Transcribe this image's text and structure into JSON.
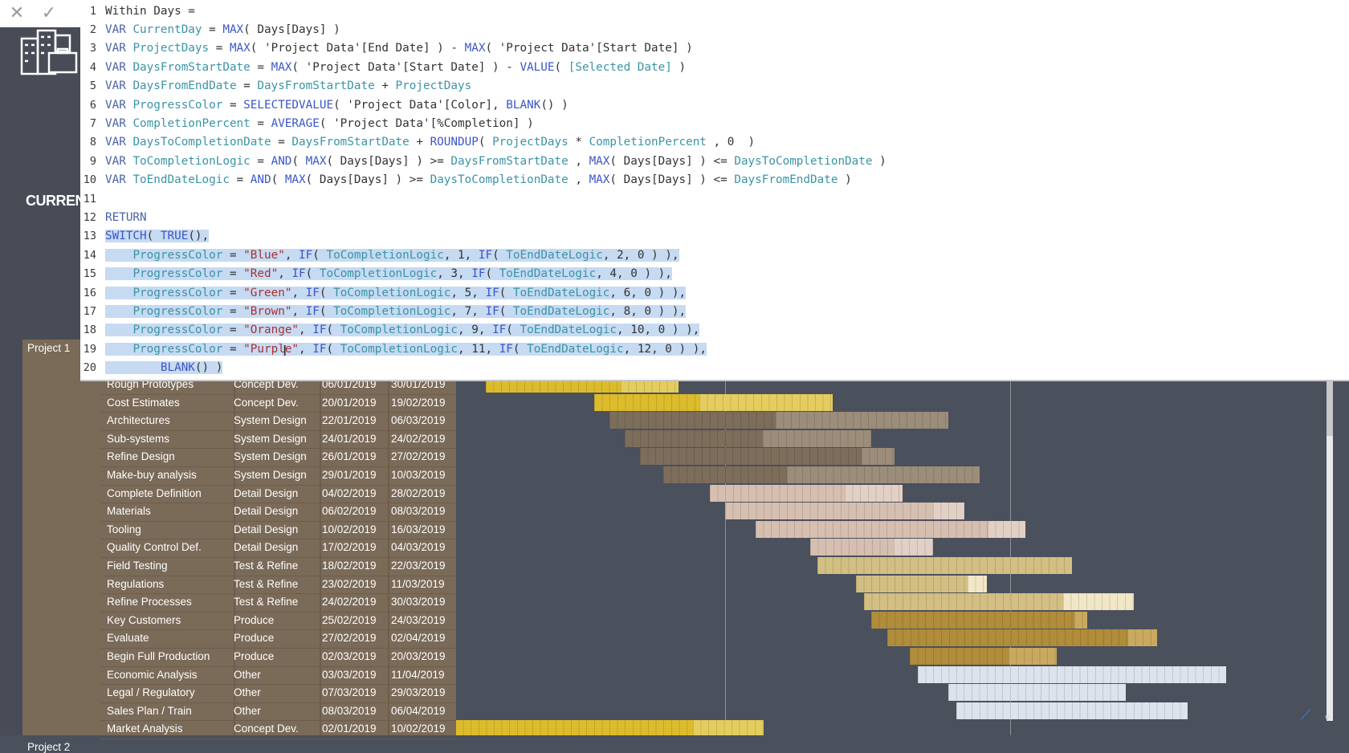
{
  "toolbar": {
    "cancel_icon": "close-icon",
    "commit_icon": "check-icon"
  },
  "left_panel": {
    "logo": "buildings-briefcase-icon",
    "label": "CURREN"
  },
  "editor": {
    "lines": [
      [
        [
          "Within Days =",
          "p"
        ]
      ],
      [
        [
          "VAR ",
          "k"
        ],
        [
          "CurrentDay",
          "v"
        ],
        [
          " = ",
          "p"
        ],
        [
          "MAX",
          "f"
        ],
        [
          "( Days[Days] )",
          "p"
        ]
      ],
      [
        [
          "VAR ",
          "k"
        ],
        [
          "ProjectDays",
          "v"
        ],
        [
          " = ",
          "p"
        ],
        [
          "MAX",
          "f"
        ],
        [
          "( 'Project Data'[End Date] ) - ",
          "p"
        ],
        [
          "MAX",
          "f"
        ],
        [
          "( 'Project Data'[Start Date] )",
          "p"
        ]
      ],
      [
        [
          "VAR ",
          "k"
        ],
        [
          "DaysFromStartDate",
          "v"
        ],
        [
          " = ",
          "p"
        ],
        [
          "MAX",
          "f"
        ],
        [
          "( 'Project Data'[Start Date] ) - ",
          "p"
        ],
        [
          "VALUE",
          "f"
        ],
        [
          "( ",
          "p"
        ],
        [
          "[Selected Date]",
          "v"
        ],
        [
          " )",
          "p"
        ]
      ],
      [
        [
          "VAR ",
          "k"
        ],
        [
          "DaysFromEndDate",
          "v"
        ],
        [
          " = ",
          "p"
        ],
        [
          "DaysFromStartDate",
          "v"
        ],
        [
          " + ",
          "p"
        ],
        [
          "ProjectDays",
          "v"
        ]
      ],
      [
        [
          "VAR ",
          "k"
        ],
        [
          "ProgressColor",
          "v"
        ],
        [
          " = ",
          "p"
        ],
        [
          "SELECTEDVALUE",
          "f"
        ],
        [
          "( 'Project Data'[Color], ",
          "p"
        ],
        [
          "BLANK",
          "f"
        ],
        [
          "() )",
          "p"
        ]
      ],
      [
        [
          "VAR ",
          "k"
        ],
        [
          "CompletionPercent",
          "v"
        ],
        [
          " = ",
          "p"
        ],
        [
          "AVERAGE",
          "f"
        ],
        [
          "( 'Project Data'[%Completion] )",
          "p"
        ]
      ],
      [
        [
          "VAR ",
          "k"
        ],
        [
          "DaysToCompletionDate",
          "v"
        ],
        [
          " = ",
          "p"
        ],
        [
          "DaysFromStartDate",
          "v"
        ],
        [
          " + ",
          "p"
        ],
        [
          "ROUNDUP",
          "f"
        ],
        [
          "( ",
          "p"
        ],
        [
          "ProjectDays",
          "v"
        ],
        [
          " * ",
          "p"
        ],
        [
          "CompletionPercent",
          "v"
        ],
        [
          " , 0  )",
          "p"
        ]
      ],
      [
        [
          "VAR ",
          "k"
        ],
        [
          "ToCompletionLogic",
          "v"
        ],
        [
          " = ",
          "p"
        ],
        [
          "AND",
          "f"
        ],
        [
          "( ",
          "p"
        ],
        [
          "MAX",
          "f"
        ],
        [
          "( Days[Days] ) >= ",
          "p"
        ],
        [
          "DaysFromStartDate",
          "v"
        ],
        [
          " , ",
          "p"
        ],
        [
          "MAX",
          "f"
        ],
        [
          "( Days[Days] ) <= ",
          "p"
        ],
        [
          "DaysToCompletionDate",
          "v"
        ],
        [
          " )",
          "p"
        ]
      ],
      [
        [
          "VAR ",
          "k"
        ],
        [
          "ToEndDateLogic",
          "v"
        ],
        [
          " = ",
          "p"
        ],
        [
          "AND",
          "f"
        ],
        [
          "( ",
          "p"
        ],
        [
          "MAX",
          "f"
        ],
        [
          "( Days[Days] ) >= ",
          "p"
        ],
        [
          "DaysToCompletionDate",
          "v"
        ],
        [
          " , ",
          "p"
        ],
        [
          "MAX",
          "f"
        ],
        [
          "( Days[Days] ) <= ",
          "p"
        ],
        [
          "DaysFromEndDate",
          "v"
        ],
        [
          " )",
          "p"
        ]
      ],
      [],
      [
        [
          "RETURN",
          "k"
        ]
      ],
      [
        [
          "SWITCH",
          "f"
        ],
        [
          "( ",
          "p"
        ],
        [
          "TRUE",
          "f"
        ],
        [
          "(),",
          "p"
        ]
      ],
      [
        [
          "    ",
          "p"
        ],
        [
          "ProgressColor",
          "v"
        ],
        [
          " = ",
          "p"
        ],
        [
          "\"Blue\"",
          "s"
        ],
        [
          ", ",
          "p"
        ],
        [
          "IF",
          "f"
        ],
        [
          "( ",
          "p"
        ],
        [
          "ToCompletionLogic",
          "v"
        ],
        [
          ", 1, ",
          "p"
        ],
        [
          "IF",
          "f"
        ],
        [
          "( ",
          "p"
        ],
        [
          "ToEndDateLogic",
          "v"
        ],
        [
          ", 2, 0 ) ),",
          "p"
        ]
      ],
      [
        [
          "    ",
          "p"
        ],
        [
          "ProgressColor",
          "v"
        ],
        [
          " = ",
          "p"
        ],
        [
          "\"Red\"",
          "s"
        ],
        [
          ", ",
          "p"
        ],
        [
          "IF",
          "f"
        ],
        [
          "( ",
          "p"
        ],
        [
          "ToCompletionLogic",
          "v"
        ],
        [
          ", 3, ",
          "p"
        ],
        [
          "IF",
          "f"
        ],
        [
          "( ",
          "p"
        ],
        [
          "ToEndDateLogic",
          "v"
        ],
        [
          ", 4, 0 ) ),",
          "p"
        ]
      ],
      [
        [
          "    ",
          "p"
        ],
        [
          "ProgressColor",
          "v"
        ],
        [
          " = ",
          "p"
        ],
        [
          "\"Green\"",
          "s"
        ],
        [
          ", ",
          "p"
        ],
        [
          "IF",
          "f"
        ],
        [
          "( ",
          "p"
        ],
        [
          "ToCompletionLogic",
          "v"
        ],
        [
          ", 5, ",
          "p"
        ],
        [
          "IF",
          "f"
        ],
        [
          "( ",
          "p"
        ],
        [
          "ToEndDateLogic",
          "v"
        ],
        [
          ", 6, 0 ) ),",
          "p"
        ]
      ],
      [
        [
          "    ",
          "p"
        ],
        [
          "ProgressColor",
          "v"
        ],
        [
          " = ",
          "p"
        ],
        [
          "\"Brown\"",
          "s"
        ],
        [
          ", ",
          "p"
        ],
        [
          "IF",
          "f"
        ],
        [
          "( ",
          "p"
        ],
        [
          "ToCompletionLogic",
          "v"
        ],
        [
          ", 7, ",
          "p"
        ],
        [
          "IF",
          "f"
        ],
        [
          "( ",
          "p"
        ],
        [
          "ToEndDateLogic",
          "v"
        ],
        [
          ", 8, 0 ) ),",
          "p"
        ]
      ],
      [
        [
          "    ",
          "p"
        ],
        [
          "ProgressColor",
          "v"
        ],
        [
          " = ",
          "p"
        ],
        [
          "\"Orange\"",
          "s"
        ],
        [
          ", ",
          "p"
        ],
        [
          "IF",
          "f"
        ],
        [
          "( ",
          "p"
        ],
        [
          "ToCompletionLogic",
          "v"
        ],
        [
          ", 9, ",
          "p"
        ],
        [
          "IF",
          "f"
        ],
        [
          "( ",
          "p"
        ],
        [
          "ToEndDateLogic",
          "v"
        ],
        [
          ", 10, 0 ) ),",
          "p"
        ]
      ],
      [
        [
          "    ",
          "p"
        ],
        [
          "ProgressColor",
          "v"
        ],
        [
          " = ",
          "p"
        ],
        [
          "\"Purple\"",
          "s"
        ],
        [
          ", ",
          "p"
        ],
        [
          "IF",
          "f"
        ],
        [
          "( ",
          "p"
        ],
        [
          "ToCompletionLogic",
          "v"
        ],
        [
          ", 11, ",
          "p"
        ],
        [
          "IF",
          "f"
        ],
        [
          "( ",
          "p"
        ],
        [
          "ToEndDateLogic",
          "v"
        ],
        [
          ", 12, 0 ) ),",
          "p"
        ]
      ],
      [
        [
          "        ",
          "p"
        ],
        [
          "BLANK",
          "f"
        ],
        [
          "() )",
          "p"
        ]
      ]
    ],
    "selected_lines": [
      13,
      14,
      15,
      16,
      17,
      18,
      19,
      20
    ]
  },
  "table": {
    "projects": [
      {
        "label": "Project 1",
        "first_row": 0
      },
      {
        "label": "Project 2",
        "first_row": 20
      }
    ],
    "rows": [
      {
        "task": "Rough Prototypes",
        "phase": "Concept Dev.",
        "start": "06/01/2019",
        "end": "30/01/2019",
        "completion": 0.7
      },
      {
        "task": "Cost Estimates",
        "phase": "Concept Dev.",
        "start": "20/01/2019",
        "end": "19/02/2019",
        "completion": 0.44
      },
      {
        "task": "Architectures",
        "phase": "System Design",
        "start": "22/01/2019",
        "end": "06/03/2019",
        "completion": 0.49
      },
      {
        "task": "Sub-systems",
        "phase": "System Design",
        "start": "24/01/2019",
        "end": "24/02/2019",
        "completion": 0.56
      },
      {
        "task": "Refine Design",
        "phase": "System Design",
        "start": "26/01/2019",
        "end": "27/02/2019",
        "completion": 0.87
      },
      {
        "task": "Make-buy analysis",
        "phase": "System Design",
        "start": "29/01/2019",
        "end": "10/03/2019",
        "completion": 0.39
      },
      {
        "task": "Complete Definition",
        "phase": "Detail Design",
        "start": "04/02/2019",
        "end": "28/02/2019",
        "completion": 0.7
      },
      {
        "task": "Materials",
        "phase": "Detail Design",
        "start": "06/02/2019",
        "end": "08/03/2019",
        "completion": 0.87
      },
      {
        "task": "Tooling",
        "phase": "Detail Design",
        "start": "10/02/2019",
        "end": "16/03/2019",
        "completion": 0.86
      },
      {
        "task": "Quality Control Def.",
        "phase": "Detail Design",
        "start": "17/02/2019",
        "end": "04/03/2019",
        "completion": 0.68
      },
      {
        "task": "Field Testing",
        "phase": "Test & Refine",
        "start": "18/02/2019",
        "end": "22/03/2019",
        "completion": 1.0
      },
      {
        "task": "Regulations",
        "phase": "Test & Refine",
        "start": "23/02/2019",
        "end": "11/03/2019",
        "completion": 0.85
      },
      {
        "task": "Refine Processes",
        "phase": "Test & Refine",
        "start": "24/02/2019",
        "end": "30/03/2019",
        "completion": 0.74
      },
      {
        "task": "Key Customers",
        "phase": "Produce",
        "start": "25/02/2019",
        "end": "24/03/2019",
        "completion": 0.94
      },
      {
        "task": "Evaluate",
        "phase": "Produce",
        "start": "27/02/2019",
        "end": "02/04/2019",
        "completion": 0.89
      },
      {
        "task": "Begin Full Production",
        "phase": "Produce",
        "start": "02/03/2019",
        "end": "20/03/2019",
        "completion": 0.67
      },
      {
        "task": "Economic Analysis",
        "phase": "Other",
        "start": "03/03/2019",
        "end": "11/04/2019",
        "completion": 1.0
      },
      {
        "task": "Legal / Regulatory",
        "phase": "Other",
        "start": "07/03/2019",
        "end": "29/03/2019",
        "completion": 1.0
      },
      {
        "task": "Sales Plan / Train",
        "phase": "Other",
        "start": "08/03/2019",
        "end": "06/04/2019",
        "completion": 1.0
      },
      {
        "task": "Market Analysis",
        "phase": "Concept Dev.",
        "start": "02/01/2019",
        "end": "10/02/2019",
        "completion": 0.77
      }
    ]
  },
  "phase_colors": {
    "Concept Dev.": [
      "#dcbc2c",
      "#e4cd5e"
    ],
    "System Design": [
      "#7d6d5b",
      "#9c8d7b"
    ],
    "Detail Design": [
      "#d6bfb1",
      "#e2d0c6"
    ],
    "Test & Refine": [
      "#d3bf83",
      "#f1e7c6"
    ],
    "Produce": [
      "#b08c3b",
      "#c9a95f"
    ],
    "Other": [
      "#dde3ec",
      "#e3e8f0"
    ]
  },
  "gantt": {
    "marker_dates": [
      "06/02/2019",
      "15/03/2019"
    ]
  }
}
